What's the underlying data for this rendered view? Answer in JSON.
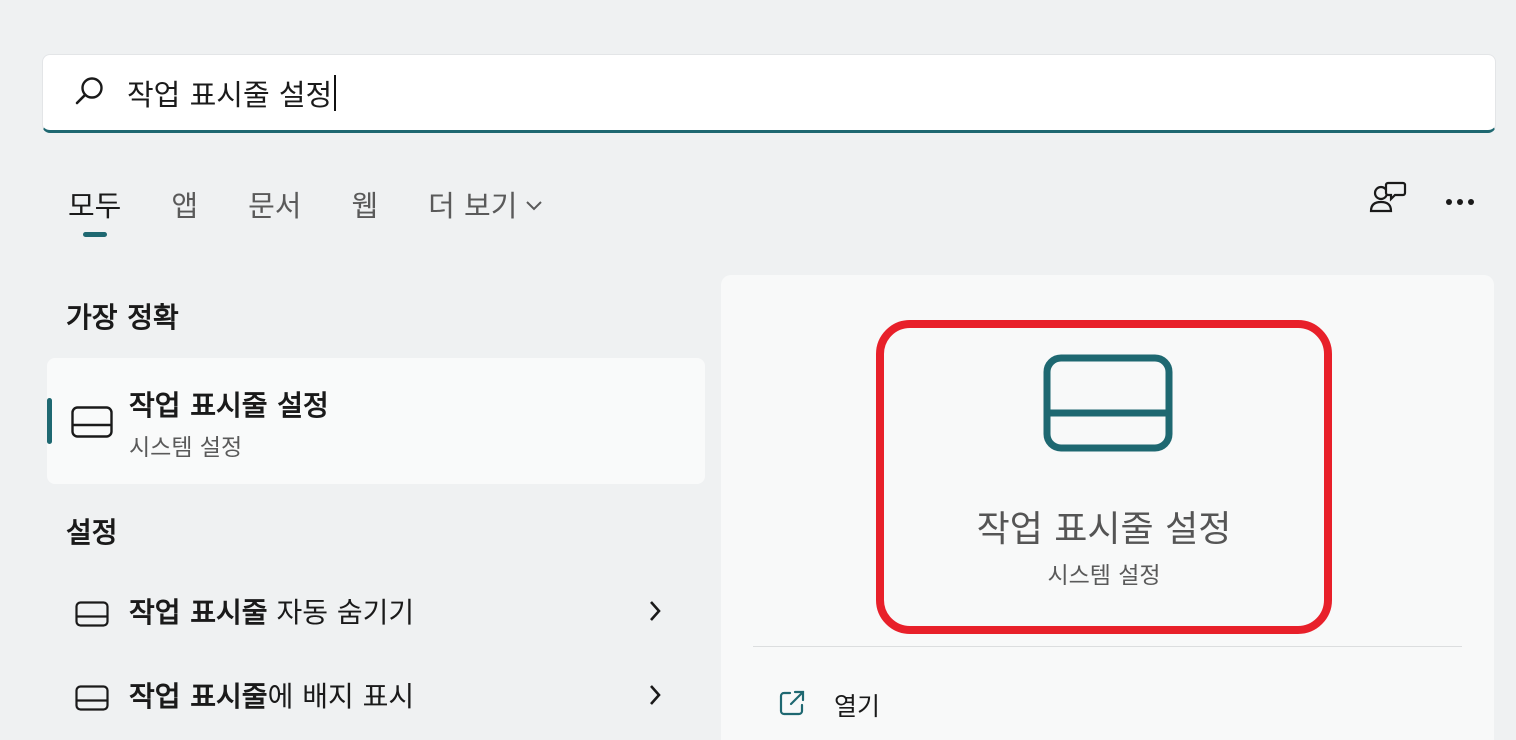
{
  "search": {
    "value": "작업 표시줄 설정"
  },
  "tabs": [
    {
      "label": "모두",
      "active": true
    },
    {
      "label": "앱"
    },
    {
      "label": "문서"
    },
    {
      "label": "웹"
    },
    {
      "label": "더 보기"
    }
  ],
  "best_match": {
    "section": "가장 정확",
    "title": "작업 표시줄 설정",
    "subtitle": "시스템 설정"
  },
  "settings": {
    "section": "설정",
    "items": [
      {
        "bold": "작업 표시줄",
        "rest": " 자동 숨기기"
      },
      {
        "bold": "작업 표시줄",
        "rest": "에 배지 표시"
      }
    ]
  },
  "detail": {
    "title": "작업 표시줄 설정",
    "subtitle": "시스템 설정",
    "open_label": "열기"
  },
  "colors": {
    "accent": "#1e6871",
    "highlight": "#e8202a"
  }
}
